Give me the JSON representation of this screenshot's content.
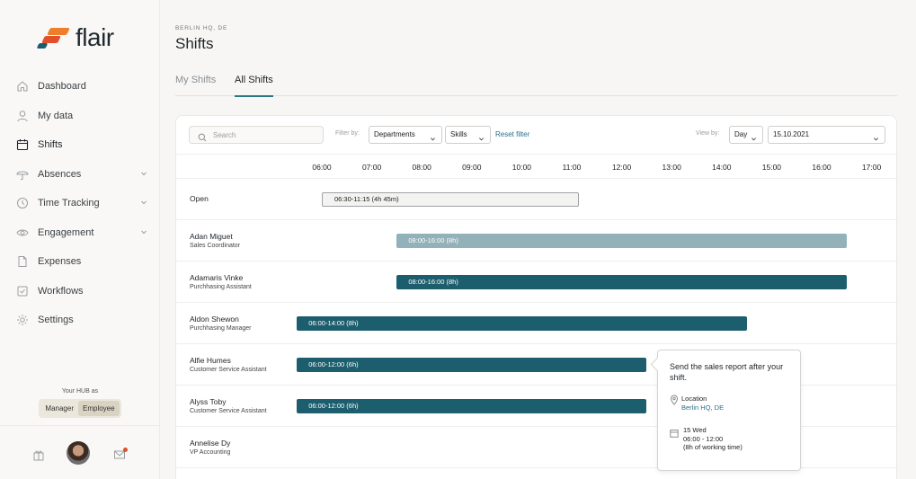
{
  "brand": {
    "name": "flair"
  },
  "sidebar": {
    "items": [
      {
        "label": "Dashboard",
        "icon": "home-icon"
      },
      {
        "label": "My data",
        "icon": "user-icon"
      },
      {
        "label": "Shifts",
        "icon": "calendar-icon"
      },
      {
        "label": "Absences",
        "icon": "umbrella-icon"
      },
      {
        "label": "Time Tracking",
        "icon": "clock-icon"
      },
      {
        "label": "Engagement",
        "icon": "eye-icon"
      },
      {
        "label": "Expenses",
        "icon": "file-icon"
      },
      {
        "label": "Workflows",
        "icon": "check-square-icon"
      },
      {
        "label": "Settings",
        "icon": "gear-icon"
      }
    ],
    "hub": {
      "label": "Your HUB as",
      "options": [
        "Manager",
        "Employee"
      ],
      "selected": "Employee"
    }
  },
  "header": {
    "location": "BERLIN HQ, DE",
    "title": "Shifts"
  },
  "tabs": [
    {
      "label": "My Shifts"
    },
    {
      "label": "All Shifts"
    }
  ],
  "toolbar": {
    "search_placeholder": "Search",
    "filter_label": "Filter by:",
    "departments": "Departments",
    "skills": "Skills",
    "reset": "Reset filter",
    "viewby_label": "View by:",
    "view": "Day",
    "date": "15.10.2021"
  },
  "timeline": {
    "hours": [
      "06:00",
      "07:00",
      "08:00",
      "09:00",
      "10:00",
      "11:00",
      "12:00",
      "13:00",
      "14:00",
      "15:00",
      "16:00",
      "17:00"
    ]
  },
  "rows": [
    {
      "name": "Open",
      "role": "",
      "shift": {
        "label": "06:30-11:15 (4h 45m)",
        "start": 6.0,
        "end": 11.15,
        "style": "open"
      }
    },
    {
      "name": "Adan Miguet",
      "role": "Sales Coordinator",
      "shift": {
        "label": "08:00-16:00 (8h)",
        "start": 7.5,
        "end": 16.5,
        "style": "light"
      }
    },
    {
      "name": "Adamaris Vinke",
      "role": "Purchhasing Assistant",
      "shift": {
        "label": "08:00-16:00 (8h)",
        "start": 7.5,
        "end": 16.5,
        "style": "dark"
      }
    },
    {
      "name": "Aldon Shewon",
      "role": "Purchhasing Manager",
      "shift": {
        "label": "06:00-14:00 (8h)",
        "start": 5.5,
        "end": 14.5,
        "style": "dark"
      }
    },
    {
      "name": "Alfie Humes",
      "role": "Customer Service Assistant",
      "shift": {
        "label": "06:00-12:00 (6h)",
        "start": 5.5,
        "end": 12.5,
        "style": "dark"
      }
    },
    {
      "name": "Alyss Toby",
      "role": "Customer Service Assistant",
      "shift": {
        "label": "06:00-12:00 (6h)",
        "start": 5.5,
        "end": 12.5,
        "style": "dark"
      }
    },
    {
      "name": "Annelise Dy",
      "role": "VP Accounting",
      "shift": null
    }
  ],
  "popover": {
    "message": "Send the sales report after your shift.",
    "location_title": "Location",
    "location_value": "Berlin HQ, DE",
    "date": "15 Wed",
    "time": "06:00 - 12:00",
    "note": "(8h of working time)"
  },
  "colors": {
    "accent": "#1d5e6e",
    "accent_light": "#93b1b8",
    "brand_orange": "#f07d2b",
    "link": "#2a6f8a"
  }
}
